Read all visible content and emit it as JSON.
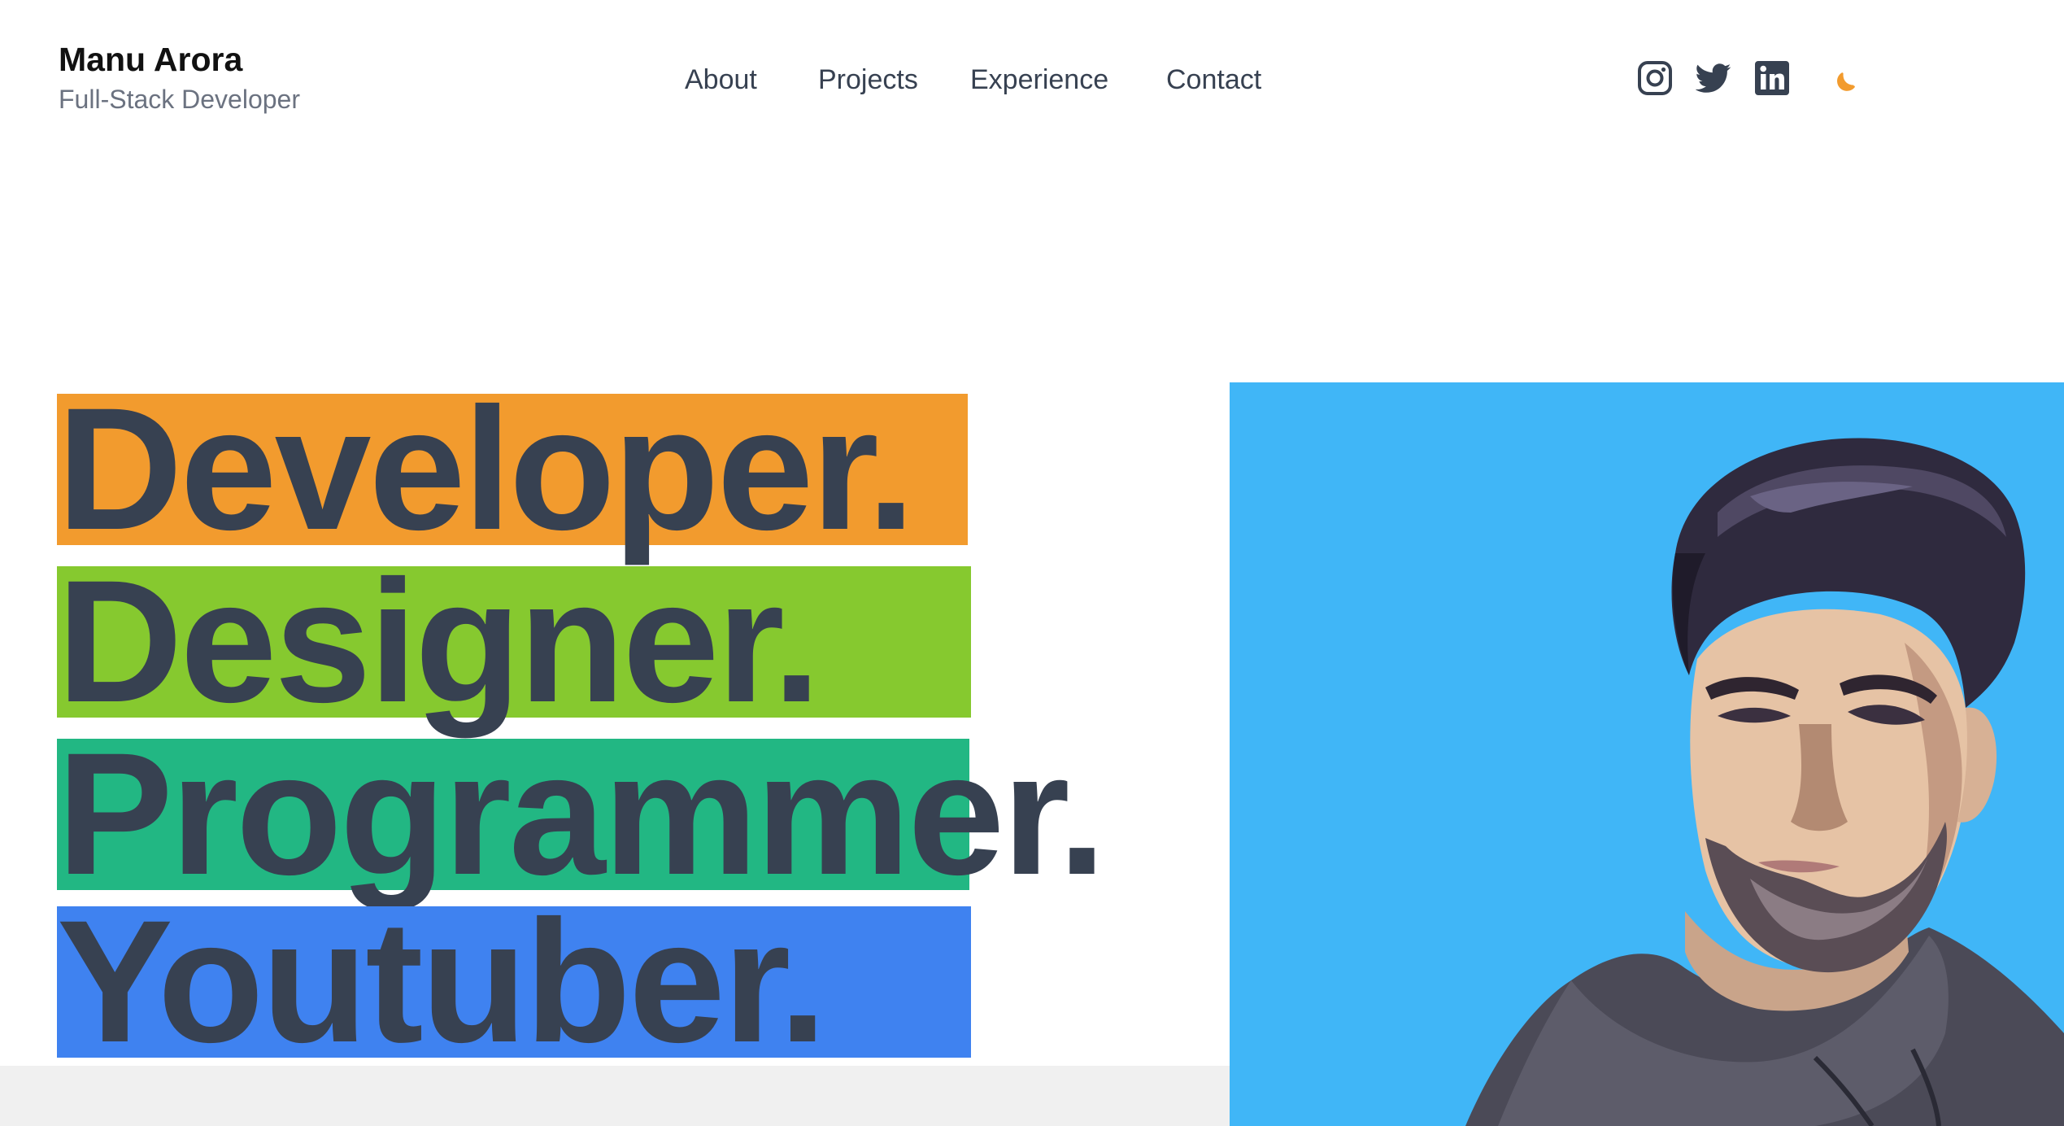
{
  "header": {
    "name": "Manu Arora",
    "tagline": "Full-Stack Developer"
  },
  "nav": {
    "items": [
      {
        "label": "About"
      },
      {
        "label": "Projects"
      },
      {
        "label": "Experience"
      },
      {
        "label": "Contact"
      }
    ]
  },
  "social": {
    "icons": [
      "instagram-icon",
      "twitter-icon",
      "linkedin-icon",
      "moon-icon"
    ]
  },
  "hero": {
    "words": [
      {
        "text": "Developer.",
        "color": "#f29b2e"
      },
      {
        "text": "Designer.",
        "color": "#86c92f"
      },
      {
        "text": "Programmer.",
        "color": "#22b783"
      },
      {
        "text": "Youtuber.",
        "color": "#3f82f0"
      }
    ]
  },
  "colors": {
    "text": "#374151",
    "muted": "#6b7280",
    "accent_moon": "#f29b2e",
    "portrait_bg": "#40b6f7",
    "footer_strip": "#f0f0f0"
  }
}
